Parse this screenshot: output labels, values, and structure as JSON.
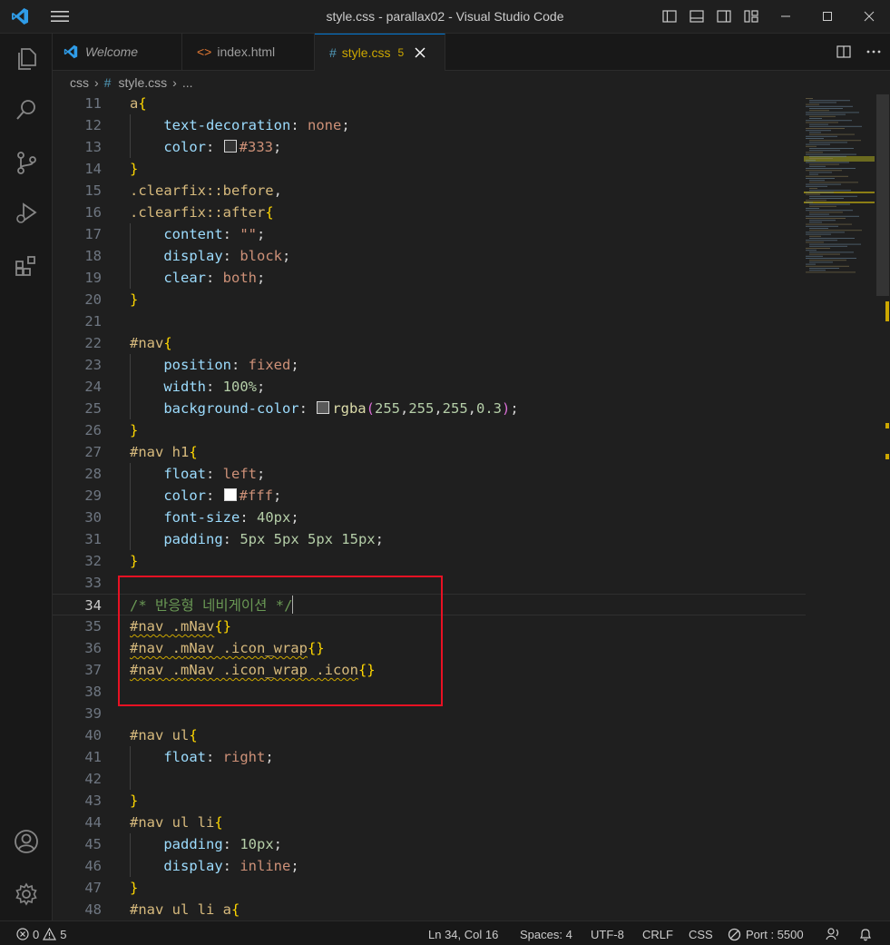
{
  "window": {
    "title": "style.css - parallax02 - Visual Studio Code",
    "accent": "#0078d4"
  },
  "tabs": [
    {
      "label": "Welcome",
      "icon": "vscode-icon"
    },
    {
      "label": "index.html",
      "icon": "html-icon"
    },
    {
      "label": "style.css",
      "icon": "css-hash-icon",
      "problems": "5"
    }
  ],
  "breadcrumb": {
    "folder": "css",
    "file": "style.css",
    "symbol": "..."
  },
  "editor": {
    "cursor_line": 34,
    "lines": [
      {
        "n": "11",
        "t": [
          [
            "sel",
            "a"
          ],
          [
            "br",
            "{"
          ]
        ]
      },
      {
        "n": "12",
        "t": [
          [
            "pun",
            "    "
          ],
          [
            "prop",
            "text-decoration"
          ],
          [
            "pun",
            ": "
          ],
          [
            "val",
            "none"
          ],
          [
            "pun",
            ";"
          ]
        ]
      },
      {
        "n": "13",
        "t": [
          [
            "pun",
            "    "
          ],
          [
            "prop",
            "color"
          ],
          [
            "pun",
            ": "
          ],
          [
            "sw",
            "#333333"
          ],
          [
            "val",
            "#333"
          ],
          [
            "pun",
            ";"
          ]
        ]
      },
      {
        "n": "14",
        "t": [
          [
            "br",
            "}"
          ]
        ]
      },
      {
        "n": "15",
        "t": [
          [
            "sel",
            ".clearfix::before"
          ],
          [
            "pun",
            ","
          ]
        ]
      },
      {
        "n": "16",
        "t": [
          [
            "sel",
            ".clearfix::after"
          ],
          [
            "br",
            "{"
          ]
        ]
      },
      {
        "n": "17",
        "t": [
          [
            "pun",
            "    "
          ],
          [
            "prop",
            "content"
          ],
          [
            "pun",
            ": "
          ],
          [
            "val",
            "\"\""
          ],
          [
            "pun",
            ";"
          ]
        ]
      },
      {
        "n": "18",
        "t": [
          [
            "pun",
            "    "
          ],
          [
            "prop",
            "display"
          ],
          [
            "pun",
            ": "
          ],
          [
            "val",
            "block"
          ],
          [
            "pun",
            ";"
          ]
        ]
      },
      {
        "n": "19",
        "t": [
          [
            "pun",
            "    "
          ],
          [
            "prop",
            "clear"
          ],
          [
            "pun",
            ": "
          ],
          [
            "val",
            "both"
          ],
          [
            "pun",
            ";"
          ]
        ]
      },
      {
        "n": "20",
        "t": [
          [
            "br",
            "}"
          ]
        ]
      },
      {
        "n": "21",
        "t": []
      },
      {
        "n": "22",
        "t": [
          [
            "sel",
            "#nav"
          ],
          [
            "br",
            "{"
          ]
        ]
      },
      {
        "n": "23",
        "t": [
          [
            "pun",
            "    "
          ],
          [
            "prop",
            "position"
          ],
          [
            "pun",
            ": "
          ],
          [
            "val",
            "fixed"
          ],
          [
            "pun",
            ";"
          ]
        ]
      },
      {
        "n": "24",
        "t": [
          [
            "pun",
            "    "
          ],
          [
            "prop",
            "width"
          ],
          [
            "pun",
            ": "
          ],
          [
            "num",
            "100%"
          ],
          [
            "pun",
            ";"
          ]
        ]
      },
      {
        "n": "25",
        "t": [
          [
            "pun",
            "    "
          ],
          [
            "prop",
            "background-color"
          ],
          [
            "pun",
            ": "
          ],
          [
            "sw",
            "#595959"
          ],
          [
            "fn",
            "rgba"
          ],
          [
            "brp",
            "("
          ],
          [
            "num",
            "255"
          ],
          [
            "pun",
            ","
          ],
          [
            "num",
            "255"
          ],
          [
            "pun",
            ","
          ],
          [
            "num",
            "255"
          ],
          [
            "pun",
            ","
          ],
          [
            "num",
            "0.3"
          ],
          [
            "brp",
            ")"
          ],
          [
            "pun",
            ";"
          ]
        ]
      },
      {
        "n": "26",
        "t": [
          [
            "br",
            "}"
          ]
        ]
      },
      {
        "n": "27",
        "t": [
          [
            "sel",
            "#nav h1"
          ],
          [
            "br",
            "{"
          ]
        ]
      },
      {
        "n": "28",
        "t": [
          [
            "pun",
            "    "
          ],
          [
            "prop",
            "float"
          ],
          [
            "pun",
            ": "
          ],
          [
            "val",
            "left"
          ],
          [
            "pun",
            ";"
          ]
        ]
      },
      {
        "n": "29",
        "t": [
          [
            "pun",
            "    "
          ],
          [
            "prop",
            "color"
          ],
          [
            "pun",
            ": "
          ],
          [
            "sw",
            "#ffffff"
          ],
          [
            "val",
            "#fff"
          ],
          [
            "pun",
            ";"
          ]
        ]
      },
      {
        "n": "30",
        "t": [
          [
            "pun",
            "    "
          ],
          [
            "prop",
            "font-size"
          ],
          [
            "pun",
            ": "
          ],
          [
            "num",
            "40px"
          ],
          [
            "pun",
            ";"
          ]
        ]
      },
      {
        "n": "31",
        "t": [
          [
            "pun",
            "    "
          ],
          [
            "prop",
            "padding"
          ],
          [
            "pun",
            ": "
          ],
          [
            "num",
            "5px 5px 5px 15px"
          ],
          [
            "pun",
            ";"
          ]
        ]
      },
      {
        "n": "32",
        "t": [
          [
            "br",
            "}"
          ]
        ]
      },
      {
        "n": "33",
        "t": []
      },
      {
        "n": "34",
        "t": [
          [
            "cmt",
            "/* 반응형 네비게이션 */"
          ]
        ]
      },
      {
        "n": "35",
        "t": [
          [
            "sel sq",
            "#nav .mNav"
          ],
          [
            "br",
            "{}"
          ]
        ]
      },
      {
        "n": "36",
        "t": [
          [
            "sel sq",
            "#nav .mNav .icon_wrap"
          ],
          [
            "br",
            "{}"
          ]
        ]
      },
      {
        "n": "37",
        "t": [
          [
            "sel sq",
            "#nav .mNav .icon_wrap .icon"
          ],
          [
            "br",
            "{}"
          ]
        ]
      },
      {
        "n": "38",
        "t": []
      },
      {
        "n": "39",
        "t": []
      },
      {
        "n": "40",
        "t": [
          [
            "sel",
            "#nav ul"
          ],
          [
            "br",
            "{"
          ]
        ]
      },
      {
        "n": "41",
        "t": [
          [
            "pun",
            "    "
          ],
          [
            "prop",
            "float"
          ],
          [
            "pun",
            ": "
          ],
          [
            "val",
            "right"
          ],
          [
            "pun",
            ";"
          ]
        ]
      },
      {
        "n": "42",
        "t": []
      },
      {
        "n": "43",
        "t": [
          [
            "br",
            "}"
          ]
        ]
      },
      {
        "n": "44",
        "t": [
          [
            "sel",
            "#nav ul li"
          ],
          [
            "br",
            "{"
          ]
        ]
      },
      {
        "n": "45",
        "t": [
          [
            "pun",
            "    "
          ],
          [
            "prop",
            "padding"
          ],
          [
            "pun",
            ": "
          ],
          [
            "num",
            "10px"
          ],
          [
            "pun",
            ";"
          ]
        ]
      },
      {
        "n": "46",
        "t": [
          [
            "pun",
            "    "
          ],
          [
            "prop",
            "display"
          ],
          [
            "pun",
            ": "
          ],
          [
            "val",
            "inline"
          ],
          [
            "pun",
            ";"
          ]
        ]
      },
      {
        "n": "47",
        "t": [
          [
            "br",
            "}"
          ]
        ]
      },
      {
        "n": "48",
        "t": [
          [
            "sel",
            "#nav ul li a"
          ],
          [
            "br",
            "{"
          ]
        ]
      }
    ]
  },
  "statusbar": {
    "errors": "0",
    "warnings": "5",
    "position": "Ln 34, Col 16",
    "spaces": "Spaces: 4",
    "encoding": "UTF-8",
    "eol": "CRLF",
    "language": "CSS",
    "port": "Port : 5500"
  }
}
